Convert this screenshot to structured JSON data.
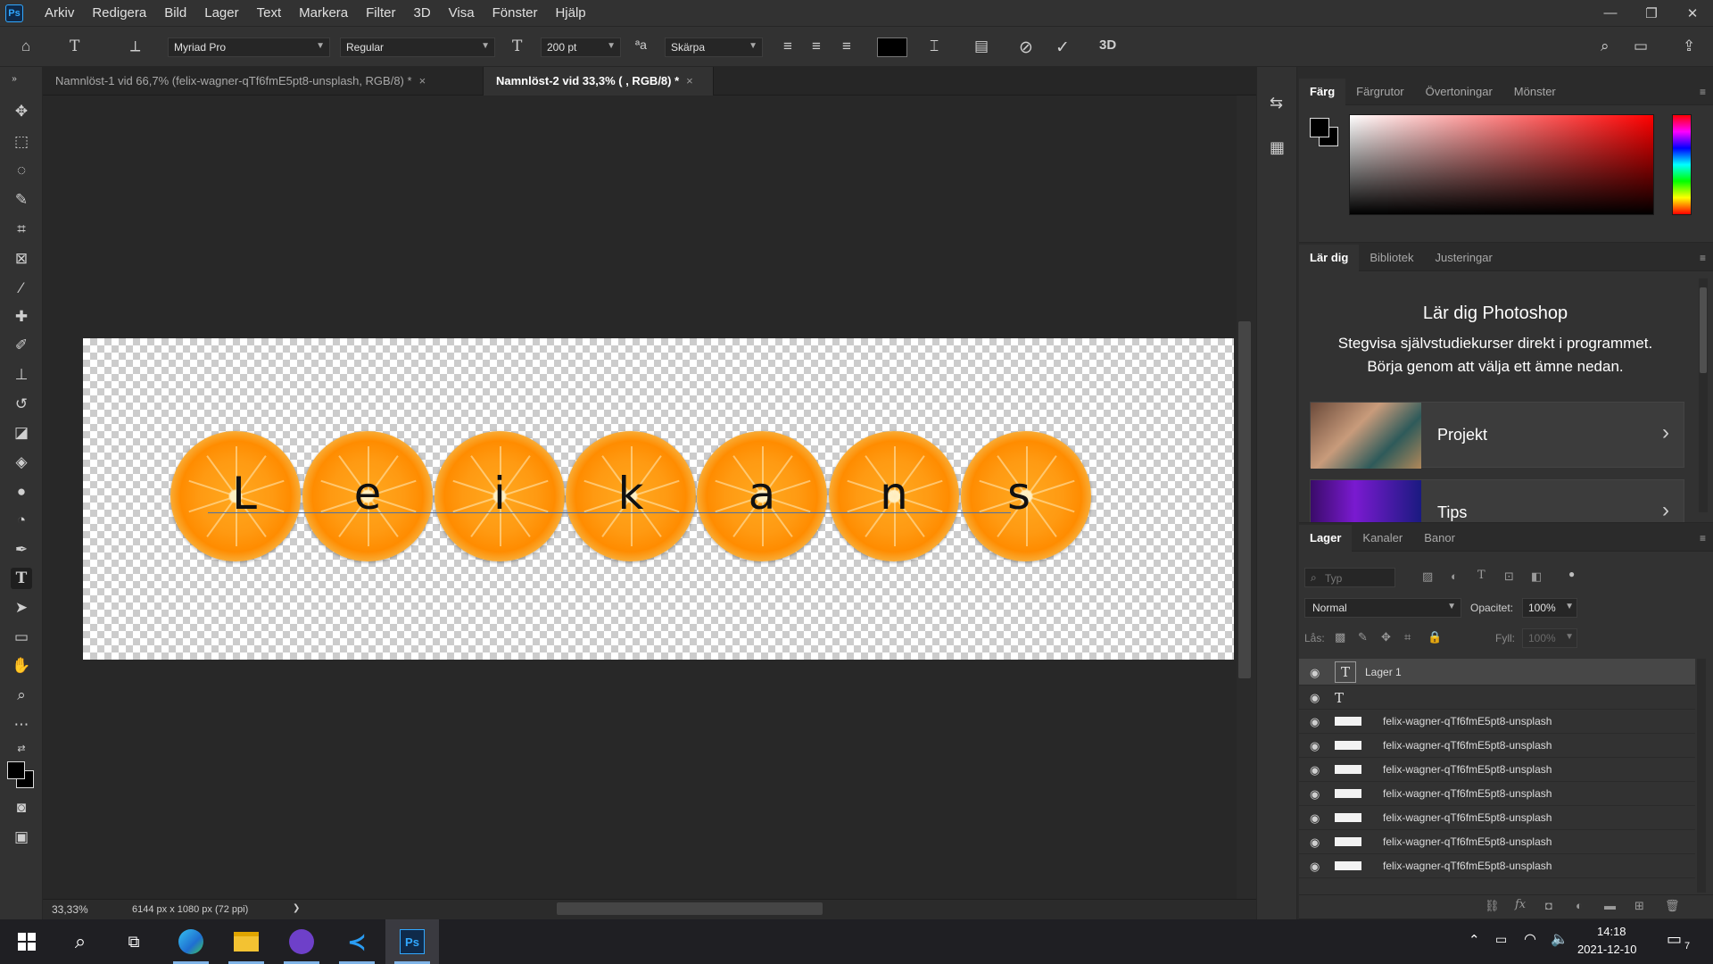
{
  "app": {
    "logo": "Ps"
  },
  "menu": [
    "Arkiv",
    "Redigera",
    "Bild",
    "Lager",
    "Text",
    "Markera",
    "Filter",
    "3D",
    "Visa",
    "Fönster",
    "Hjälp"
  ],
  "window_controls": {
    "minimize": "—",
    "restore": "❐",
    "close": "✕"
  },
  "options": {
    "font_family": "Myriad Pro",
    "font_style": "Regular",
    "font_size": "200 pt",
    "anti_alias": "Skärpa",
    "aa_label": "ªa",
    "three_d": "3D",
    "text_color": "#000000"
  },
  "tabs": [
    {
      "label": "Namnlöst-1 vid 66,7% (felix-wagner-qTf6fmE5pt8-unsplash, RGB/8) *",
      "close": "×"
    },
    {
      "label": "Namnlöst-2 vid 33,3% ( , RGB/8) *",
      "close": "×"
    }
  ],
  "canvas": {
    "letters": [
      "L",
      "e",
      "i",
      "k",
      "a",
      "n",
      "s"
    ]
  },
  "status": {
    "zoom": "33,33%",
    "doc_info": "6144 px x 1080 px (72 ppi)",
    "arrow": "❯"
  },
  "color_panel": {
    "tabs": [
      "Färg",
      "Färgrutor",
      "Övertoningar",
      "Mönster"
    ]
  },
  "learn_panel": {
    "tabs": [
      "Lär dig",
      "Bibliotek",
      "Justeringar"
    ],
    "title": "Lär dig Photoshop",
    "subtitle_line1": "Stegvisa självstudiekurser direkt i programmet.",
    "subtitle_line2": "Börja genom att välja ett ämne nedan.",
    "cards": [
      {
        "label": "Projekt",
        "arrow": "›"
      },
      {
        "label": "Tips",
        "arrow": "›"
      }
    ]
  },
  "layers_panel": {
    "tabs": [
      "Lager",
      "Kanaler",
      "Banor"
    ],
    "search_placeholder": "Typ",
    "blend_mode": "Normal",
    "opacity_label": "Opacitet:",
    "opacity_value": "100%",
    "lock_label": "Lås:",
    "fill_label": "Fyll:",
    "fill_value": "100%",
    "layers": [
      {
        "name": "Lager 1",
        "kind": "text",
        "selected": true
      },
      {
        "name": "",
        "kind": "text",
        "selected": false
      },
      {
        "name": "felix-wagner-qTf6fmE5pt8-unsplash",
        "kind": "image",
        "selected": false
      },
      {
        "name": "felix-wagner-qTf6fmE5pt8-unsplash",
        "kind": "image",
        "selected": false
      },
      {
        "name": "felix-wagner-qTf6fmE5pt8-unsplash",
        "kind": "image",
        "selected": false
      },
      {
        "name": "felix-wagner-qTf6fmE5pt8-unsplash",
        "kind": "image",
        "selected": false
      },
      {
        "name": "felix-wagner-qTf6fmE5pt8-unsplash",
        "kind": "image",
        "selected": false
      },
      {
        "name": "felix-wagner-qTf6fmE5pt8-unsplash",
        "kind": "image",
        "selected": false
      },
      {
        "name": "felix-wagner-qTf6fmE5pt8-unsplash",
        "kind": "image",
        "selected": false
      }
    ]
  },
  "taskbar": {
    "time": "14:18",
    "date": "2021-12-10",
    "notifications": "7"
  },
  "colors": {
    "accent": "#31a8ff",
    "panel_bg": "#323232",
    "canvas_bg": "#282828",
    "orange": "#ff8c00"
  }
}
